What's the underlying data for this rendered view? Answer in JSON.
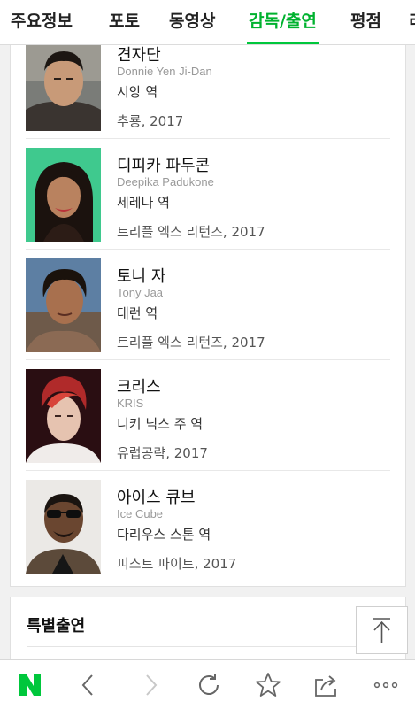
{
  "tabs": [
    {
      "label": "주요정보",
      "active": false
    },
    {
      "label": "포토",
      "active": false
    },
    {
      "label": "동영상",
      "active": false
    },
    {
      "label": "감독/출연",
      "active": true
    },
    {
      "label": "평점",
      "active": false
    },
    {
      "label": "리",
      "active": false
    }
  ],
  "cast": [
    {
      "name": "견자단",
      "english": "Donnie Yen Ji-Dan",
      "role": "시앙 역",
      "film": "추룡, 2017"
    },
    {
      "name": "디피카 파두콘",
      "english": "Deepika Padukone",
      "role": "세레나 역",
      "film": "트리플 엑스 리턴즈, 2017"
    },
    {
      "name": "토니 자",
      "english": "Tony Jaa",
      "role": "태런 역",
      "film": "트리플 엑스 리턴즈, 2017"
    },
    {
      "name": "크리스",
      "english": "KRIS",
      "role": "니키 닉스 주 역",
      "film": "유럽공략, 2017"
    },
    {
      "name": "아이스 큐브",
      "english": "Ice Cube",
      "role": "다리우스 스톤 역",
      "film": "피스트 파이트, 2017"
    }
  ],
  "special": {
    "title": "특별출연"
  },
  "colors": {
    "accent": "#00c73c",
    "naver_logo": "#00c73c"
  },
  "bottom_bar": {
    "logo": "N",
    "icons": [
      "back-icon",
      "forward-icon",
      "refresh-icon",
      "bookmark-star-icon",
      "share-icon",
      "more-icon"
    ]
  }
}
